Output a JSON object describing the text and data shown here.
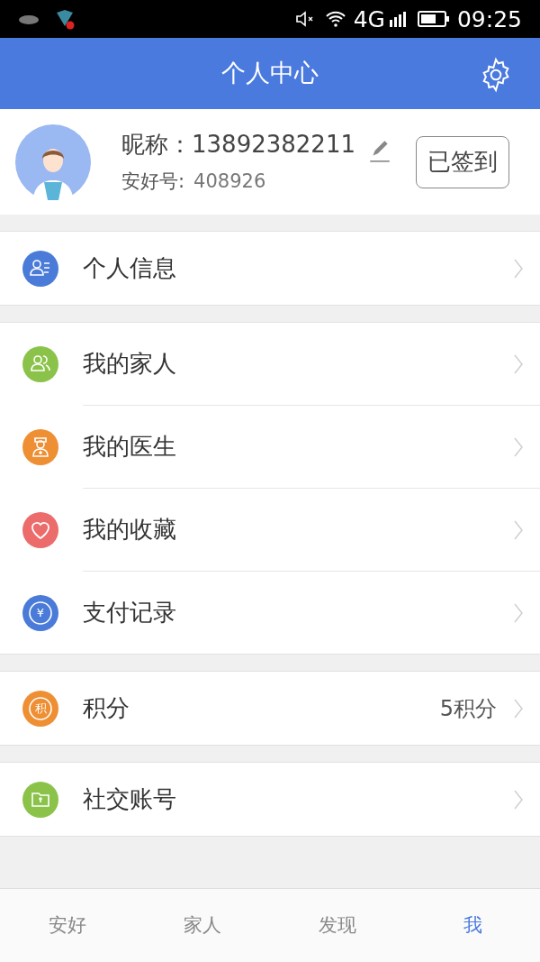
{
  "status_bar": {
    "network": "4G",
    "time": "09:25"
  },
  "header": {
    "title": "个人中心"
  },
  "profile": {
    "nickname_label": "昵称：",
    "nickname": "13892382211",
    "id_label": "安好号:",
    "id": "408926",
    "checkin_button": "已签到"
  },
  "groups": [
    {
      "rows": [
        {
          "label": "个人信息",
          "color": "#4a7bd8"
        }
      ]
    },
    {
      "rows": [
        {
          "label": "我的家人",
          "color": "#8bc34a"
        },
        {
          "label": "我的医生",
          "color": "#ef8f34"
        },
        {
          "label": "我的收藏",
          "color": "#ec6b6b"
        },
        {
          "label": "支付记录",
          "color": "#4a7bd8",
          "icon_text": "¥"
        }
      ]
    },
    {
      "rows": [
        {
          "label": "积分",
          "color": "#ef8f34",
          "icon_text": "积",
          "value": "5积分"
        }
      ]
    },
    {
      "rows": [
        {
          "label": "社交账号",
          "color": "#8bc34a"
        }
      ]
    }
  ],
  "tabs": [
    {
      "label": "安好",
      "selected": false
    },
    {
      "label": "家人",
      "selected": false
    },
    {
      "label": "发现",
      "selected": false
    },
    {
      "label": "我",
      "selected": true
    }
  ]
}
